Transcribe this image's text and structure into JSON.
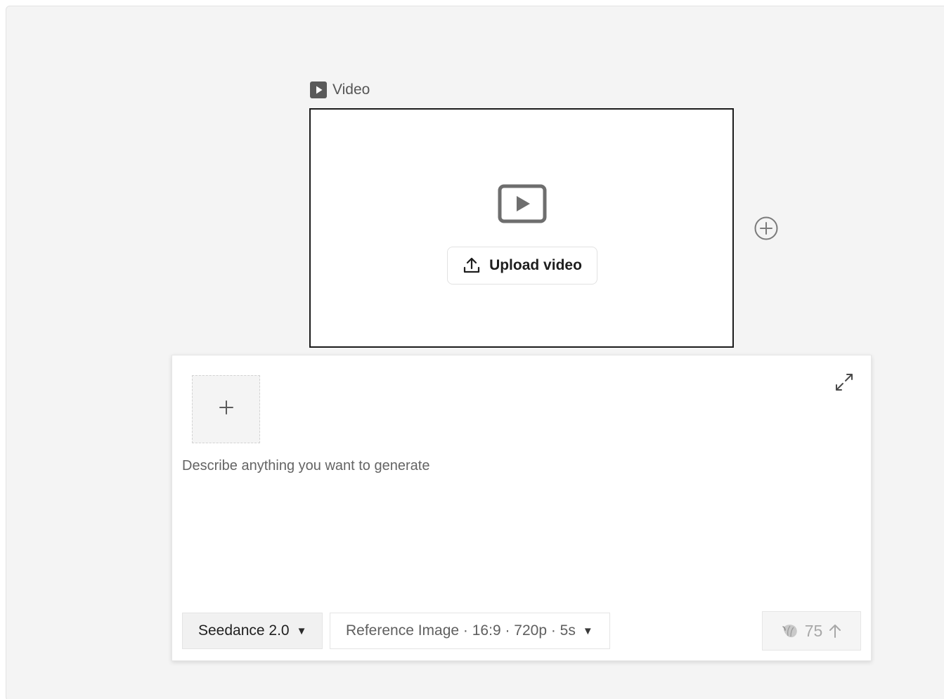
{
  "video_node": {
    "label": "Video",
    "label_icon": "play-square-icon",
    "placeholder_icon": "video-play-icon",
    "upload_button": {
      "label": "Upload video",
      "icon": "upload-icon"
    }
  },
  "add_node_button": {
    "icon": "plus-circle-icon"
  },
  "prompt_panel": {
    "add_reference": {
      "icon": "plus-icon"
    },
    "expand": {
      "icon": "expand-icon"
    },
    "prompt": {
      "value": "",
      "placeholder": "Describe anything you want to generate"
    },
    "model_select": {
      "value": "Seedance 2.0",
      "caret": "▼"
    },
    "settings_select": {
      "value": "Reference Image · 16:9 · 720p · 5s",
      "caret": "▼"
    },
    "submit": {
      "credits": "75",
      "credit_icon": "seashell-icon",
      "arrow_icon": "arrow-up-icon"
    }
  },
  "colors": {
    "canvas": "#f4f4f4",
    "node_border": "#1b1b1b",
    "muted_text": "#646464"
  }
}
